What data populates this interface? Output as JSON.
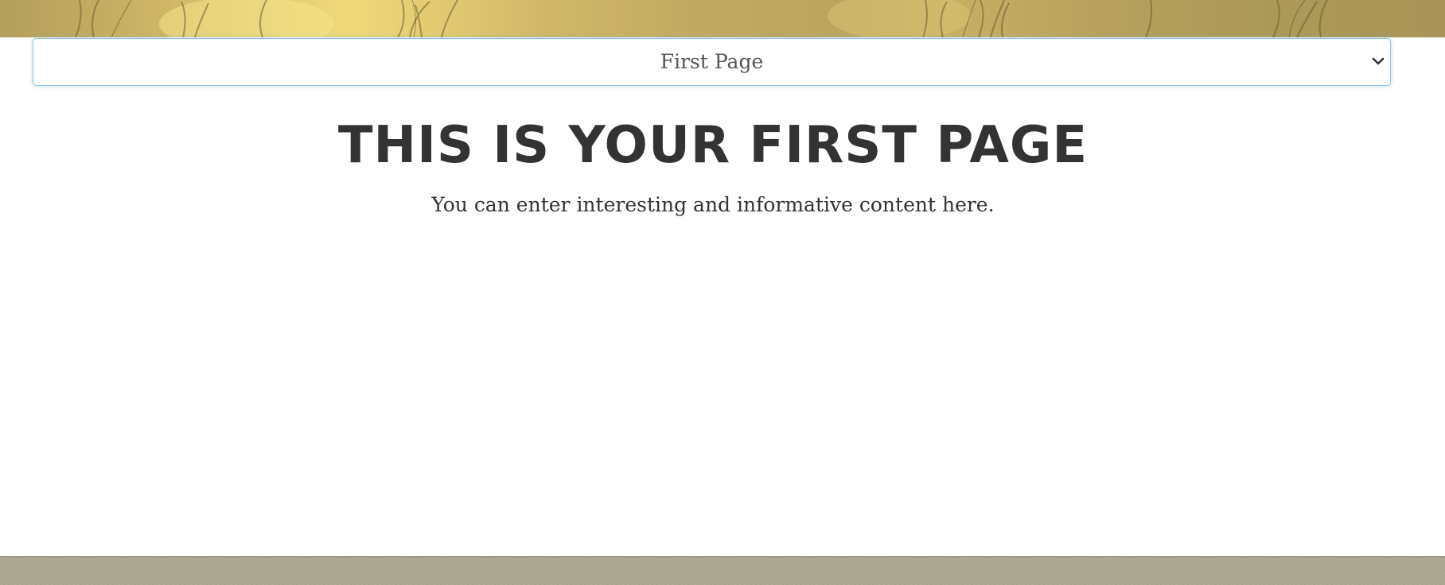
{
  "page_selector": {
    "selected": "First Page"
  },
  "content": {
    "title": "THIS IS YOUR FIRST PAGE",
    "subtitle": "You can enter interesting and informative content here."
  },
  "icons": {
    "dropdown": "chevron-down-icon"
  },
  "colors": {
    "heading_text": "#333333",
    "select_text": "#555555",
    "select_focus_border": "#8ec3e6",
    "footer_band": "#a8a48d",
    "banner_gold": "#d7bd6a"
  }
}
